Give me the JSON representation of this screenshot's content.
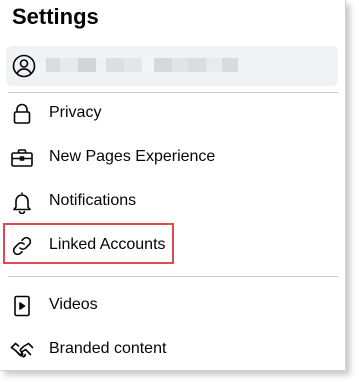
{
  "header": {
    "title": "Settings"
  },
  "account": {
    "avatar_icon": "user-circle-icon"
  },
  "menu": {
    "items": [
      {
        "label": "Privacy",
        "icon": "lock-icon"
      },
      {
        "label": "New Pages Experience",
        "icon": "briefcase-icon"
      },
      {
        "label": "Notifications",
        "icon": "bell-icon"
      },
      {
        "label": "Linked Accounts",
        "icon": "link-icon"
      },
      {
        "label": "Videos",
        "icon": "video-icon"
      },
      {
        "label": "Branded content",
        "icon": "handshake-icon"
      }
    ]
  },
  "colors": {
    "highlight": "#e04a4f",
    "text": "#050505",
    "row_bg": "#f0f2f5"
  }
}
